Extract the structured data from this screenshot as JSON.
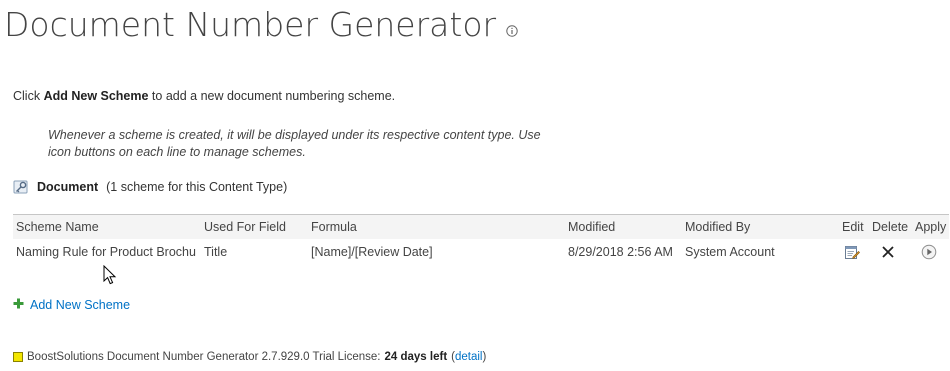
{
  "page": {
    "title": "Document Number Generator"
  },
  "intro": {
    "prefix": "Click ",
    "action": "Add New Scheme",
    "suffix": " to add a new document numbering scheme."
  },
  "note": "Whenever a scheme is created, it will be displayed under its respective content type. Use icon buttons on each line to manage schemes.",
  "content_type": {
    "name": "Document",
    "count_text": "(1 scheme for this Content Type)"
  },
  "table": {
    "headers": {
      "scheme_name": "Scheme Name",
      "used_for_field": "Used For Field",
      "formula": "Formula",
      "modified": "Modified",
      "modified_by": "Modified By",
      "edit": "Edit",
      "delete": "Delete",
      "apply": "Apply"
    },
    "rows": [
      {
        "scheme_name": "Naming Rule for Product Brochur",
        "used_for_field": "Title",
        "formula": "[Name]/[Review Date]",
        "modified": "8/29/2018 2:56 AM",
        "modified_by": "System Account",
        "edit_icon": "edit-icon",
        "delete_icon": "delete-x-icon",
        "apply_icon": "apply-play-icon"
      }
    ]
  },
  "add_new": {
    "label": "Add New Scheme",
    "icon": "plus-icon"
  },
  "footer": {
    "product": "BoostSolutions Document Number Generator 2.7.929.0 Trial License:",
    "days_left": "24 days left",
    "paren_open": "(",
    "detail_link": "detail",
    "paren_close": ")"
  },
  "colors": {
    "link": "#0072c6",
    "plus": "#3a9a3a",
    "header_bg": "#f4f4f4",
    "license_square": "#f3e600"
  }
}
